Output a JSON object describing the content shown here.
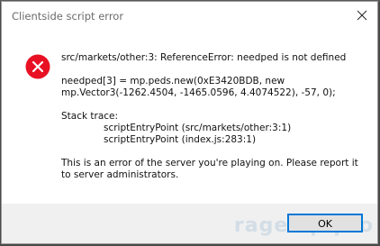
{
  "window": {
    "title": "Clientside script error"
  },
  "dialog": {
    "icon": "error-icon",
    "lines": {
      "error": "src/markets/other:3: ReferenceError: needped is not defined",
      "code1": "needped[3] = mp.peds.new(0xE3420BDB, new",
      "code2": "mp.Vector3(-1262.4504, -1465.0596, 4.4074522), -57, 0);",
      "stack_header": "Stack trace:",
      "stack1": "scriptEntryPoint (src/markets/other:3:1)",
      "stack2": "scriptEntryPoint (index.js:283:1)",
      "footer1": "This is an error of the server you're playing on. Please report it",
      "footer2": "to server administrators."
    },
    "ok_label": "OK"
  },
  "watermark": "ragemp.pro",
  "colors": {
    "error_red": "#e81123",
    "focus_blue": "#0078d7"
  }
}
